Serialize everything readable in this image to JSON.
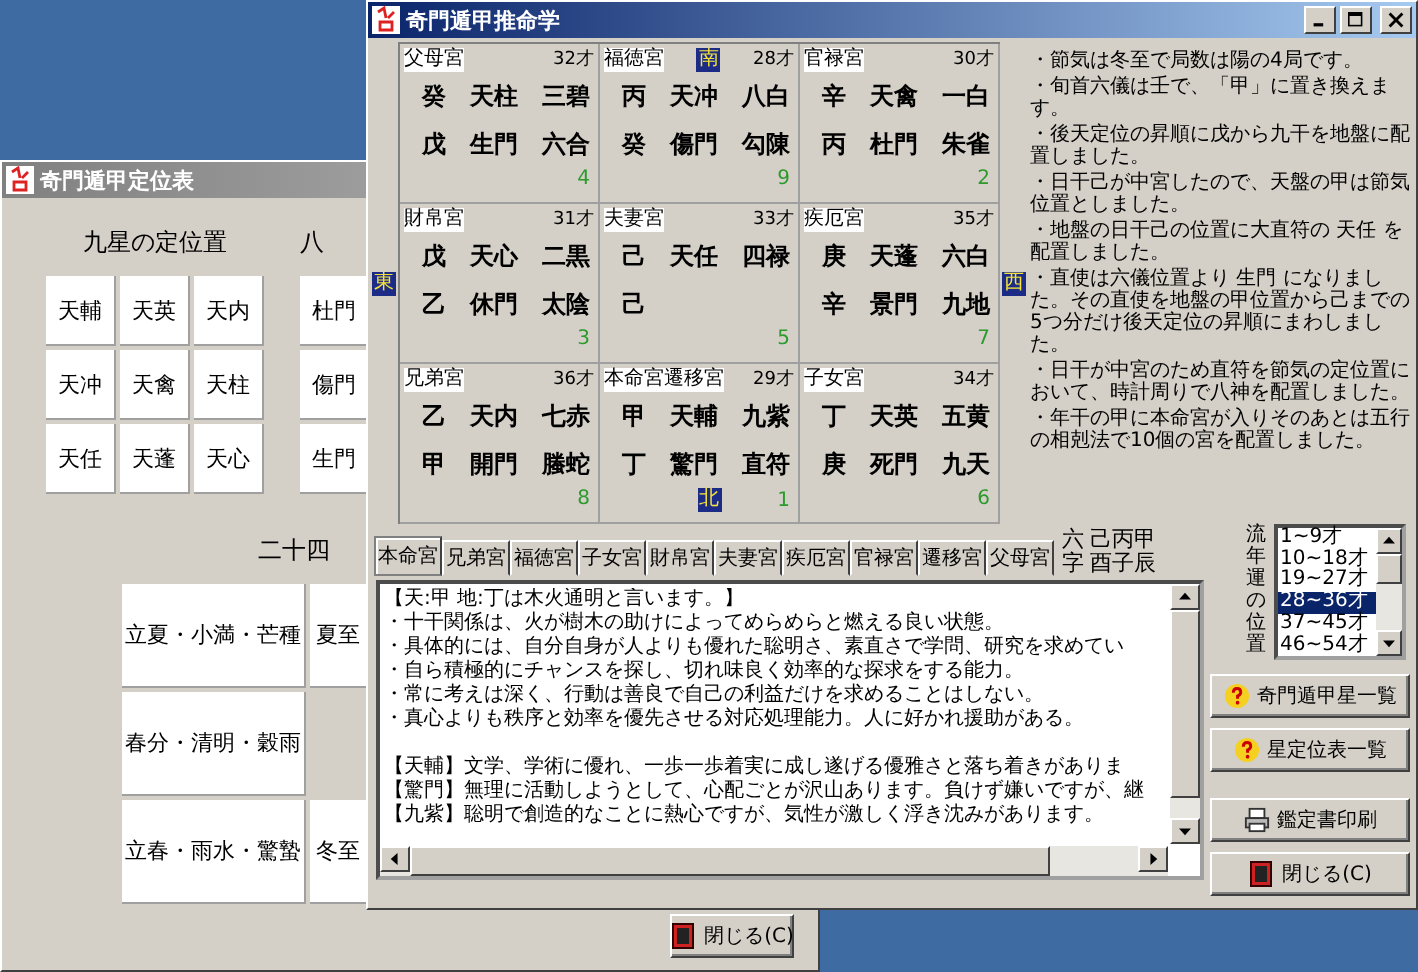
{
  "back_window": {
    "title": "奇門遁甲定位表",
    "active": false,
    "stars_heading": "九星の定位置",
    "stars": [
      "天輔",
      "天英",
      "天内",
      "天冲",
      "天禽",
      "天柱",
      "天任",
      "天蓬",
      "天心"
    ],
    "gates_heading": "八",
    "gates": [
      "杜門",
      "傷門",
      "生門"
    ],
    "solar_heading": "二十四",
    "solar_rows": [
      [
        "立夏・小満・芒種",
        "夏至"
      ],
      [
        "春分・清明・穀雨"
      ],
      [
        "立春・雨水・驚蟄",
        "冬至"
      ]
    ],
    "close_button": "閉じる(C)"
  },
  "front_window": {
    "title": "奇門遁甲推命学",
    "active": true,
    "compass": {
      "south": "南",
      "east": "東",
      "west": "西",
      "north": "北"
    },
    "palaces": [
      {
        "name": "父母宮",
        "age": "32才",
        "top": [
          "癸",
          "天柱",
          "三碧"
        ],
        "bottom": [
          "戊",
          "生門",
          "六合"
        ],
        "number": "4"
      },
      {
        "name": "福徳宮",
        "age": "28才",
        "top": [
          "丙",
          "天冲",
          "八白"
        ],
        "bottom": [
          "癸",
          "傷門",
          "勾陳"
        ],
        "number": "9"
      },
      {
        "name": "官禄宮",
        "age": "30才",
        "top": [
          "辛",
          "天禽",
          "一白"
        ],
        "bottom": [
          "丙",
          "杜門",
          "朱雀"
        ],
        "number": "2"
      },
      {
        "name": "財帛宮",
        "age": "31才",
        "top": [
          "戊",
          "天心",
          "二黒"
        ],
        "bottom": [
          "乙",
          "休門",
          "太陰"
        ],
        "number": "3"
      },
      {
        "name": "夫妻宮",
        "age": "33才",
        "top": [
          "己",
          "天任",
          "四禄"
        ],
        "bottom": [
          "己"
        ],
        "number": "5"
      },
      {
        "name": "疾厄宮",
        "age": "35才",
        "top": [
          "庚",
          "天蓬",
          "六白"
        ],
        "bottom": [
          "辛",
          "景門",
          "九地"
        ],
        "number": "7"
      },
      {
        "name": "兄弟宮",
        "age": "36才",
        "top": [
          "乙",
          "天内",
          "七赤"
        ],
        "bottom": [
          "甲",
          "開門",
          "螣蛇"
        ],
        "number": "8"
      },
      {
        "name": "本命宮遷移宮",
        "age": "29才",
        "top": [
          "甲",
          "天輔",
          "九紫"
        ],
        "bottom": [
          "丁",
          "驚門",
          "直符"
        ],
        "number": "1"
      },
      {
        "name": "子女宮",
        "age": "34才",
        "top": [
          "丁",
          "天英",
          "五黄"
        ],
        "bottom": [
          "庚",
          "死門",
          "九天"
        ],
        "number": "6"
      }
    ],
    "notes": [
      "・節気は冬至で局数は陽の4局です。",
      "・旬首六儀は壬で、「甲」に置き換えます。",
      "・後天定位の昇順に戊から九干を地盤に配置しました。",
      "・日干己が中宮したので、天盤の甲は節気位置としました。",
      "・地盤の日干己の位置に大直符の 天任 を配置しました。",
      "・直使は六儀位置より 生門 になりました。その直使を地盤の甲位置から己までの5つ分だけ後天定位の昇順にまわしました。",
      "・日干が中宮のため直符を節気の定位置において、時計周りで八神を配置しました。",
      "・年干の甲に本命宮が入りそのあとは五行の相剋法で10個の宮を配置しました。"
    ],
    "rokuji": {
      "label": "六字",
      "values": [
        "己丙甲",
        "酉子辰"
      ]
    },
    "year_list": {
      "label": "流年運の位置",
      "items": [
        {
          "text": "1~9才",
          "selected": false
        },
        {
          "text": "10~18才",
          "selected": false
        },
        {
          "text": "19~27才",
          "selected": false
        },
        {
          "text": "28~36才",
          "selected": true
        },
        {
          "text": "37~45才",
          "selected": false
        },
        {
          "text": "46~54才",
          "selected": false
        }
      ]
    },
    "tabs": [
      {
        "label": "本命宮",
        "selected": true
      },
      {
        "label": "兄弟宮",
        "selected": false
      },
      {
        "label": "福徳宮",
        "selected": false
      },
      {
        "label": "子女宮",
        "selected": false
      },
      {
        "label": "財帛宮",
        "selected": false
      },
      {
        "label": "夫妻宮",
        "selected": false
      },
      {
        "label": "疾厄宮",
        "selected": false
      },
      {
        "label": "官禄宮",
        "selected": false
      },
      {
        "label": "遷移宮",
        "selected": false
      },
      {
        "label": "父母宮",
        "selected": false
      }
    ],
    "reading": {
      "paragraphs": [
        [
          "【天:甲 地:丁は木火通明と言います。】",
          "・十干関係は、火が樹木の助けによってめらめらと燃える良い状態。",
          "・具体的には、自分自身が人よりも優れた聡明さ、素直さで学問、研究を求めてい",
          "・自ら積極的にチャンスを探し、切れ味良く効率的な探求をする能力。",
          "・常に考えは深く、行動は善良で自己の利益だけを求めることはしない。",
          "・真心よりも秩序と効率を優先させる対応処理能力。人に好かれ援助がある。"
        ],
        [
          "【天輔】文学、学術に優れ、一歩一歩着実に成し遂げる優雅さと落ち着きがありま",
          "【驚門】無理に活動しようとして、心配ごとが沢山あります。負けず嫌いですが、継",
          "【九紫】聡明で創造的なことに熱心ですが、気性が激しく浮き沈みがあります。"
        ]
      ]
    },
    "buttons": [
      {
        "label": "奇門遁甲星一覧",
        "kind": "question"
      },
      {
        "label": "星定位表一覧",
        "kind": "question"
      },
      {
        "label": "鑑定書印刷",
        "kind": "printer"
      },
      {
        "label": "閉じる(C)",
        "kind": "door"
      }
    ]
  }
}
